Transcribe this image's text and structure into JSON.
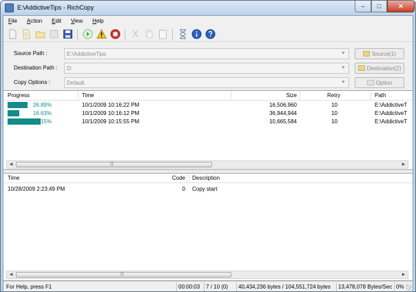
{
  "window": {
    "title": "E:\\AddictiveTips - RichCopy",
    "min_glyph": "–",
    "max_glyph": "□",
    "close_glyph": "✕"
  },
  "menu": [
    {
      "key": "F",
      "rest": "ile"
    },
    {
      "key": "A",
      "rest": "ction"
    },
    {
      "key": "E",
      "rest": "dit"
    },
    {
      "key": "V",
      "rest": "iew"
    },
    {
      "key": "H",
      "rest": "elp"
    }
  ],
  "toolbar_icons": [
    "new-icon",
    "open-icon",
    "folder-icon",
    "save-disabled-icon",
    "save-icon",
    "start-icon",
    "warning-icon",
    "stop-icon",
    "cut-icon",
    "copy-icon",
    "paste-icon",
    "hourglass-icon",
    "info-icon",
    "help-icon"
  ],
  "options": {
    "source_label": "Source Path :",
    "source_value": "E:\\AddictiveTips",
    "source_button": "Source(1)",
    "dest_label": "Destination Path :",
    "dest_value": "D:",
    "dest_button": "Destination(2)",
    "copy_label": "Copy Options :",
    "copy_value": "Default",
    "copy_button": "Option"
  },
  "file_list": {
    "headers": {
      "progress": "Progress",
      "time": "Time",
      "size": "Size",
      "retry": "Retry",
      "path": "Path"
    },
    "rows": [
      {
        "progress": 0.6,
        "percent": "26.89%",
        "time": "10/1/2009 10:16:22 PM",
        "size": "16,506,960",
        "retry": "10",
        "path": "E:\\AddictiveT"
      },
      {
        "progress": 0.35,
        "percent": "16.63%",
        "time": "10/1/2009 10:16:12 PM",
        "size": "36,944,944",
        "retry": "10",
        "path": "E:\\AddictiveT"
      },
      {
        "progress": 1.0,
        "percent": "49.15%",
        "time": "10/1/2009 10:15:55 PM",
        "size": "10,665,584",
        "retry": "10",
        "path": "E:\\AddictiveT"
      }
    ]
  },
  "log_list": {
    "headers": {
      "time": "Time",
      "code": "Code",
      "description": "Description"
    },
    "rows": [
      {
        "time": "10/28/2009 2:23:49 PM",
        "code": "0",
        "description": "Copy start"
      }
    ]
  },
  "statusbar": {
    "help": "For Help, press F1",
    "elapsed": "00:00:03",
    "files": "7 / 10 (0)",
    "bytes": "40,434,236 bytes / 104,551,724 bytes",
    "rate": "13,478,078 Bytes/Sec",
    "percent": "0%"
  },
  "colors": {
    "progress_fill": "#148c8a",
    "title_bar": "#bcd3ec",
    "close_button": "#c4412b"
  }
}
